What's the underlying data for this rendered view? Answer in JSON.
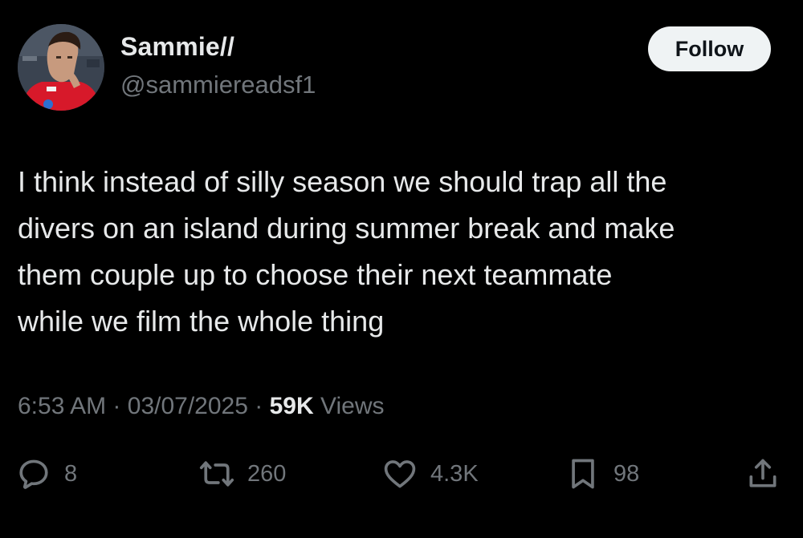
{
  "user": {
    "display_name": "Sammie//",
    "handle": "@sammiereadsf1",
    "follow_label": "Follow"
  },
  "tweet": {
    "text": "I think instead of silly season we should trap all the\ndivers on an island during summer break and make\nthem couple up to choose their next teammate\nwhile we film the whole thing"
  },
  "meta": {
    "time": "6:53 AM",
    "separator": "·",
    "date": "03/07/2025",
    "views_count": "59K",
    "views_label": "Views"
  },
  "actions": {
    "reply_count": "8",
    "retweet_count": "260",
    "like_count": "4.3K",
    "bookmark_count": "98"
  },
  "icons": {
    "reply": "reply-icon",
    "retweet": "retweet-icon",
    "like": "heart-icon",
    "bookmark": "bookmark-icon",
    "share": "share-icon"
  },
  "colors": {
    "background": "#000000",
    "primary_text": "#e7e9ea",
    "secondary_text": "#71767b",
    "follow_button_bg": "#eff3f4",
    "follow_button_text": "#0f1419"
  }
}
